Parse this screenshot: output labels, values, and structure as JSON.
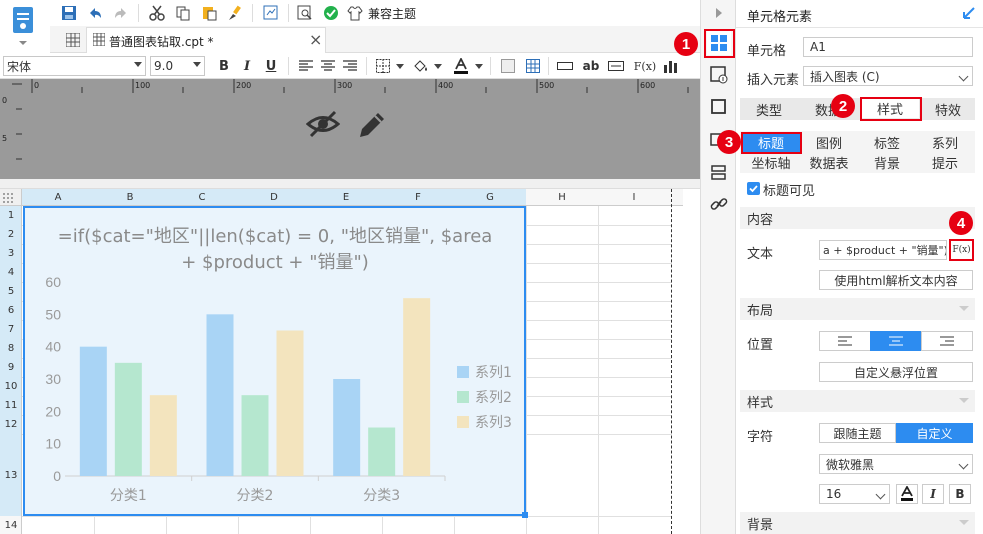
{
  "toolbar": {
    "theme_label": "兼容主题",
    "font_name": "宋体",
    "font_size": "9.0",
    "bold": "B",
    "italic": "I",
    "underline": "U",
    "fx": "F(x)",
    "ab": "ab"
  },
  "tab": {
    "title": "普通图表钻取.cpt *",
    "close": "×"
  },
  "grid": {
    "columns": [
      "A",
      "B",
      "C",
      "D",
      "E",
      "F",
      "G",
      "H",
      "I"
    ],
    "rows": [
      "1",
      "2",
      "3",
      "4",
      "5",
      "6",
      "7",
      "8",
      "9",
      "10",
      "11",
      "12",
      "13",
      "14"
    ]
  },
  "chart_data": {
    "type": "bar",
    "title": "=if($cat=\"地区\"||len($cat) = 0, \"地区销量\", $area + $product + \"销量\")",
    "title_line1": "=if($cat=\"地区\"||len($cat) = 0, \"地区销量\", $area",
    "title_line2": "+ $product + \"销量\")",
    "categories": [
      "分类1",
      "分类2",
      "分类3"
    ],
    "series": [
      {
        "name": "系列1",
        "values": [
          40,
          50,
          30
        ],
        "color": "#a9d4f5"
      },
      {
        "name": "系列2",
        "values": [
          35,
          25,
          15
        ],
        "color": "#b5e7cf"
      },
      {
        "name": "系列3",
        "values": [
          25,
          45,
          55
        ],
        "color": "#f3e4be"
      }
    ],
    "ylim": [
      0,
      60
    ],
    "yticks": [
      "0",
      "10",
      "20",
      "30",
      "40",
      "50",
      "60"
    ],
    "legend": "right",
    "grid": false
  },
  "right_panel": {
    "header": "单元格元素",
    "cell_label": "单元格",
    "cell_value": "A1",
    "insert_label": "插入元素",
    "insert_value": "插入图表 (C)",
    "main_tabs": [
      "类型",
      "数据",
      "样式",
      "特效"
    ],
    "sub_tabs_row1": [
      "标题",
      "图例",
      "标签",
      "系列"
    ],
    "sub_tabs_row2": [
      "坐标轴",
      "数据表",
      "背景",
      "提示"
    ],
    "title_visible": "标题可见",
    "content_section": "内容",
    "text_label": "文本",
    "text_value": "a + $product + \"销量\")",
    "fx_button": "F(x)",
    "html_button": "使用html解析文本内容",
    "layout_section": "布局",
    "position_label": "位置",
    "custom_float": "自定义悬浮位置",
    "style_section": "样式",
    "char_label": "字符",
    "follow_theme": "跟随主题",
    "custom": "自定义",
    "font_value": "微软雅黑",
    "size_value": "16",
    "bg_section": "背景"
  },
  "badges": [
    "1",
    "2",
    "3",
    "4"
  ],
  "colors": {
    "accent": "#2d8cf0",
    "badge": "#e60012",
    "selection": "#eaf4fc"
  }
}
